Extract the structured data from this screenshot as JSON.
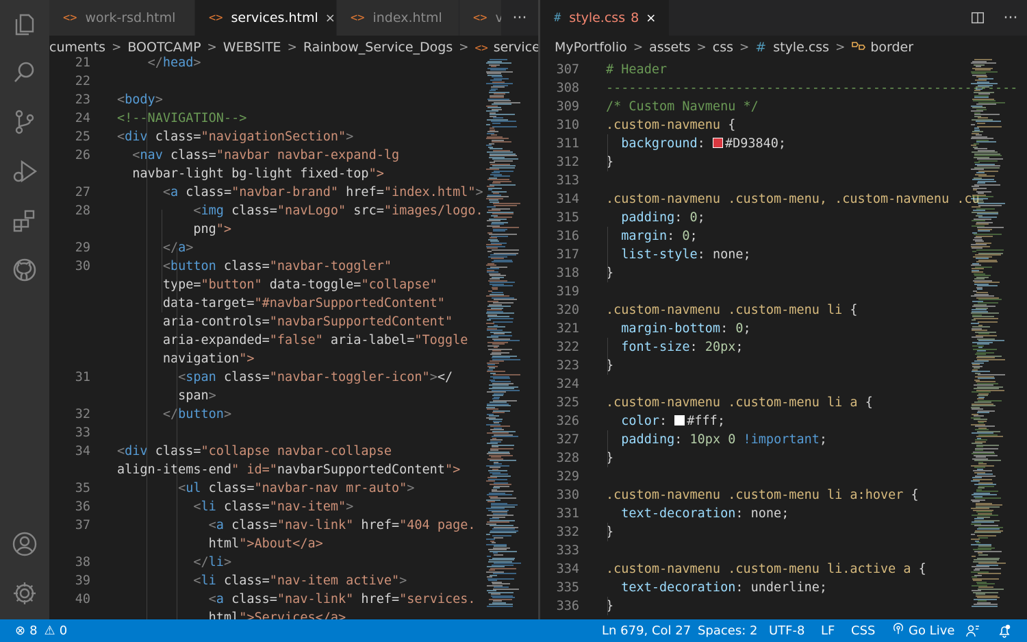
{
  "left_editor": {
    "tabs": [
      {
        "label": "work-rsd.html",
        "icon": "html-tag-icon"
      },
      {
        "label": "services.html",
        "icon": "html-tag-icon",
        "active": true
      },
      {
        "label": "index.html",
        "icon": "html-tag-icon"
      },
      {
        "label": "v",
        "icon": "html-tag-icon"
      }
    ],
    "more_label": "···",
    "close_glyph": "×",
    "breadcrumb": [
      "cuments",
      "BOOTCAMP",
      "WEBSITE",
      "Rainbow_Service_Dogs",
      "services.html"
    ],
    "lines": [
      {
        "n": "21",
        "t": "    </head>"
      },
      {
        "n": "22",
        "t": ""
      },
      {
        "n": "23",
        "t": "<body>"
      },
      {
        "n": "24",
        "t": "<!--NAVIGATION-->"
      },
      {
        "n": "25",
        "t": "<div class=\"navigationSection\">"
      },
      {
        "n": "26",
        "t": "  <nav class=\"navbar navbar-expand-lg"
      },
      {
        "n": "",
        "t": "  navbar-light bg-light fixed-top\">"
      },
      {
        "n": "27",
        "t": "      <a class=\"navbar-brand\" href=\"index.html\">"
      },
      {
        "n": "28",
        "t": "          <img class=\"navLogo\" src=\"images/logo."
      },
      {
        "n": "",
        "t": "          png\">"
      },
      {
        "n": "29",
        "t": "      </a>"
      },
      {
        "n": "30",
        "t": "      <button class=\"navbar-toggler\""
      },
      {
        "n": "",
        "t": "      type=\"button\" data-toggle=\"collapse\""
      },
      {
        "n": "",
        "t": "      data-target=\"#navbarSupportedContent\""
      },
      {
        "n": "",
        "t": "      aria-controls=\"navbarSupportedContent\""
      },
      {
        "n": "",
        "t": "      aria-expanded=\"false\" aria-label=\"Toggle"
      },
      {
        "n": "",
        "t": "      navigation\">"
      },
      {
        "n": "31",
        "t": "        <span class=\"navbar-toggler-icon\"></"
      },
      {
        "n": "",
        "t": "        span>"
      },
      {
        "n": "32",
        "t": "      </button>"
      },
      {
        "n": "33",
        "t": ""
      },
      {
        "n": "34",
        "t": "<div class=\"collapse navbar-collapse"
      },
      {
        "n": "",
        "t": "align-items-end\" id=\"navbarSupportedContent\">"
      },
      {
        "n": "35",
        "t": "        <ul class=\"navbar-nav mr-auto\">"
      },
      {
        "n": "36",
        "t": "          <li class=\"nav-item\">"
      },
      {
        "n": "37",
        "t": "            <a class=\"nav-link\" href=\"404 page."
      },
      {
        "n": "",
        "t": "            html\">About</a>"
      },
      {
        "n": "38",
        "t": "          </li>"
      },
      {
        "n": "39",
        "t": "          <li class=\"nav-item active\">"
      },
      {
        "n": "40",
        "t": "            <a class=\"nav-link\" href=\"services."
      },
      {
        "n": "",
        "t": "            html\">Services</a>"
      }
    ]
  },
  "right_editor": {
    "tab": {
      "label": "style.css",
      "problems": "8",
      "icon": "css-hash-icon"
    },
    "close_glyph": "×",
    "more_label": "···",
    "breadcrumb": [
      "MyPortfolio",
      "assets",
      "css",
      "style.css",
      "border"
    ],
    "lines": [
      {
        "n": "307",
        "t": "# Header"
      },
      {
        "n": "308",
        "t": "------------------------------------------------------------"
      },
      {
        "n": "309",
        "t": "/* Custom Navmenu */"
      },
      {
        "n": "310",
        "t": ".custom-navmenu {"
      },
      {
        "n": "311",
        "t": "  background: #D93840;"
      },
      {
        "n": "312",
        "t": "}"
      },
      {
        "n": "313",
        "t": ""
      },
      {
        "n": "314",
        "t": ".custom-navmenu .custom-menu, .custom-navmenu .cu"
      },
      {
        "n": "315",
        "t": "  padding: 0;"
      },
      {
        "n": "316",
        "t": "  margin: 0;"
      },
      {
        "n": "317",
        "t": "  list-style: none;"
      },
      {
        "n": "318",
        "t": "}"
      },
      {
        "n": "319",
        "t": ""
      },
      {
        "n": "320",
        "t": ".custom-navmenu .custom-menu li {"
      },
      {
        "n": "321",
        "t": "  margin-bottom: 0;"
      },
      {
        "n": "322",
        "t": "  font-size: 20px;"
      },
      {
        "n": "323",
        "t": "}"
      },
      {
        "n": "324",
        "t": ""
      },
      {
        "n": "325",
        "t": ".custom-navmenu .custom-menu li a {"
      },
      {
        "n": "326",
        "t": "  color: #fff;"
      },
      {
        "n": "327",
        "t": "  padding: 10px 0 !important;"
      },
      {
        "n": "328",
        "t": "}"
      },
      {
        "n": "329",
        "t": ""
      },
      {
        "n": "330",
        "t": ".custom-navmenu .custom-menu li a:hover {"
      },
      {
        "n": "331",
        "t": "  text-decoration: none;"
      },
      {
        "n": "332",
        "t": "}"
      },
      {
        "n": "333",
        "t": ""
      },
      {
        "n": "334",
        "t": ".custom-navmenu .custom-menu li.active a {"
      },
      {
        "n": "335",
        "t": "  text-decoration: underline;"
      },
      {
        "n": "336",
        "t": "}"
      }
    ]
  },
  "status_bar": {
    "errors": "8",
    "warnings": "0",
    "position": "Ln 679, Col 27",
    "spaces": "Spaces: 2",
    "encoding": "UTF-8",
    "eol": "LF",
    "language": "CSS",
    "go_live": "Go Live"
  },
  "colors": {
    "accent": "#007acc",
    "swatch_red": "#D93840",
    "swatch_white": "#ffffff"
  }
}
